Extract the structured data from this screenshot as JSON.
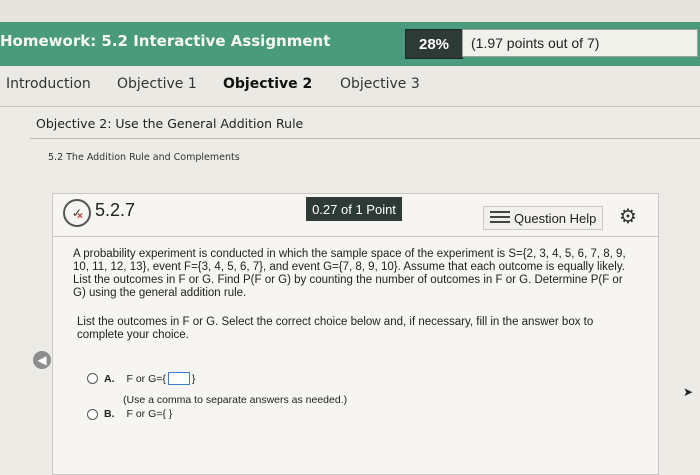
{
  "header": {
    "title": "Homework: 5.2 Interactive Assignment",
    "score_percent": "28%",
    "points": "(1.97 points out of 7)",
    "colors": {
      "accent": "#4a9a7e",
      "dark": "#2e3a35"
    }
  },
  "tabs": [
    {
      "label": "Introduction"
    },
    {
      "label": "Objective 1"
    },
    {
      "label": "Objective 2",
      "active": true
    },
    {
      "label": "Objective 3"
    }
  ],
  "objective_title": "Objective 2: Use the General Addition Rule",
  "section_subtitle": "5.2 The Addition Rule and Complements",
  "question": {
    "icon": "partial-credit-icon",
    "number": "5.2.7",
    "points_badge": "0.27 of 1 Point",
    "help_label": "Question Help",
    "text": "A probability experiment is conducted in which the sample space of the experiment is S={2, 3, 4, 5, 6, 7, 8, 9, 10, 11, 12, 13}, event F={3, 4, 5, 6, 7}, and event G={7, 8, 9, 10}. Assume that each outcome is equally likely. List the outcomes in F or G. Find P(F or G) by counting the number of outcomes in F or G. Determine P(F or G) using the general addition rule.",
    "instruction": "List the outcomes in F or G. Select the correct choice below and, if necessary, fill in the answer box to complete your choice.",
    "choices": [
      {
        "letter": "A.",
        "prefix": "F or G={",
        "suffix": "}"
      },
      {
        "letter": "B.",
        "prefix": "F or G={ }"
      }
    ],
    "hint": "(Use a comma to separate answers as needed.)"
  }
}
